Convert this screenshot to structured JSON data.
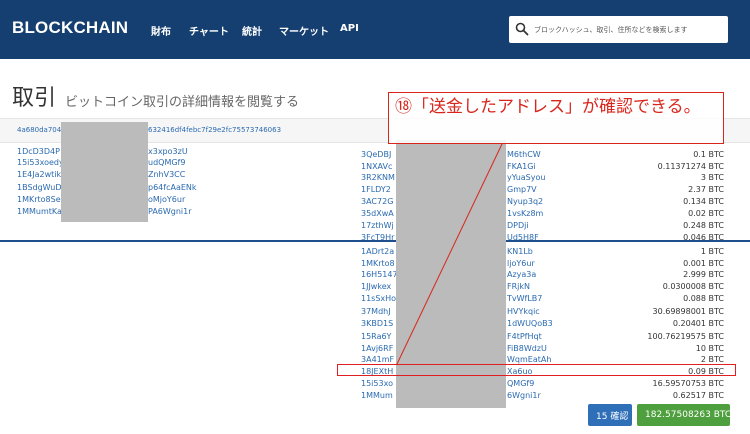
{
  "nav": {
    "brand": "BLOCKCHAIN",
    "items": [
      "財布",
      "チャート",
      "統計",
      "マーケット",
      "API"
    ],
    "search_placeholder": "ブロックハッシュ、取引、住所などを検索します"
  },
  "page": {
    "title": "取引",
    "subtitle": "ビットコイン取引の詳細情報を閲覧する"
  },
  "tx": {
    "hash_start": "4a680da704b",
    "hash_end": "632416df4febc7f29e2fc75573746063"
  },
  "inputs": [
    {
      "start": "1DcD3D4P",
      "end": "x3xpo3zU"
    },
    {
      "start": "15i53xoedy",
      "end": "udQMGf9"
    },
    {
      "start": "1E4Ja2wtik",
      "end": "ZnhV3CC"
    },
    {
      "start": "1BSdgWuD",
      "end": "p64fcAaENk"
    },
    {
      "start": "1MKrto8Se",
      "end": "oMjoY6ur"
    },
    {
      "start": "1MMumtKa",
      "end": "PA6Wgni1r"
    }
  ],
  "outputs": [
    {
      "start": "3QeDBJ",
      "end": "M6thCW",
      "amount": "0.1 BTC"
    },
    {
      "start": "1NXAVc",
      "end": "FKA1Gi",
      "amount": "0.11371274 BTC"
    },
    {
      "start": "3R2KNM",
      "end": "yYuaSyou",
      "amount": "3 BTC"
    },
    {
      "start": "1FLDY2",
      "end": "Gmp7V",
      "amount": "2.37 BTC"
    },
    {
      "start": "3AC72G",
      "end": "Nyup3q2",
      "amount": "0.134 BTC"
    },
    {
      "start": "35dXwA",
      "end": "1vsKz8m",
      "amount": "0.02 BTC"
    },
    {
      "start": "17zthWj",
      "end": "DPDji",
      "amount": "0.248 BTC"
    },
    {
      "start": "3FcT9Hr",
      "end": "Ud5H8F",
      "amount": "0.046 BTC"
    },
    {
      "start": "1ADrt2a",
      "end": "KN1Lb",
      "amount": "1 BTC"
    },
    {
      "start": "1MKrto8",
      "end": "ljoY6ur",
      "amount": "0.001 BTC"
    },
    {
      "start": "16H5147",
      "end": "Azya3a",
      "amount": "2.999 BTC"
    },
    {
      "start": "1JJwkex",
      "end": "FRjkN",
      "amount": "0.0300008 BTC"
    },
    {
      "start": "11sSxHo",
      "end": "TvWfLB7",
      "amount": "0.088 BTC"
    },
    {
      "start": "37MdhJ",
      "end": "HVYkqic",
      "amount": "30.69898001 BTC"
    },
    {
      "start": "3KBD1S",
      "end": "1dWUQoB3",
      "amount": "0.20401 BTC"
    },
    {
      "start": "15Ra6Y",
      "end": "F4tPfHqt",
      "amount": "100.76219575 BTC"
    },
    {
      "start": "1Avj6RF",
      "end": "FiB8WdzU",
      "amount": "10 BTC"
    },
    {
      "start": "3A41mF",
      "end": "WqmEatAh",
      "amount": "2 BTC"
    },
    {
      "start": "18JEXtH",
      "end": "Xa6uo",
      "amount": "0.09 BTC"
    },
    {
      "start": "15i53xo",
      "end": "QMGf9",
      "amount": "16.59570753 BTC"
    },
    {
      "start": "1MMum",
      "end": "6Wgni1r",
      "amount": "0.62517 BTC"
    }
  ],
  "buttons": {
    "confirmations": "15 確認",
    "total": "182.57508263 BTC"
  },
  "annotation": {
    "text": "⑱「送金したアドレス」が確認できる。"
  },
  "colors": {
    "navbar": "#143f70",
    "link": "#2a6ab0",
    "annotation": "#d9261c",
    "confirm_button": "#2f6fb8",
    "total_button": "#4e9f3d"
  }
}
